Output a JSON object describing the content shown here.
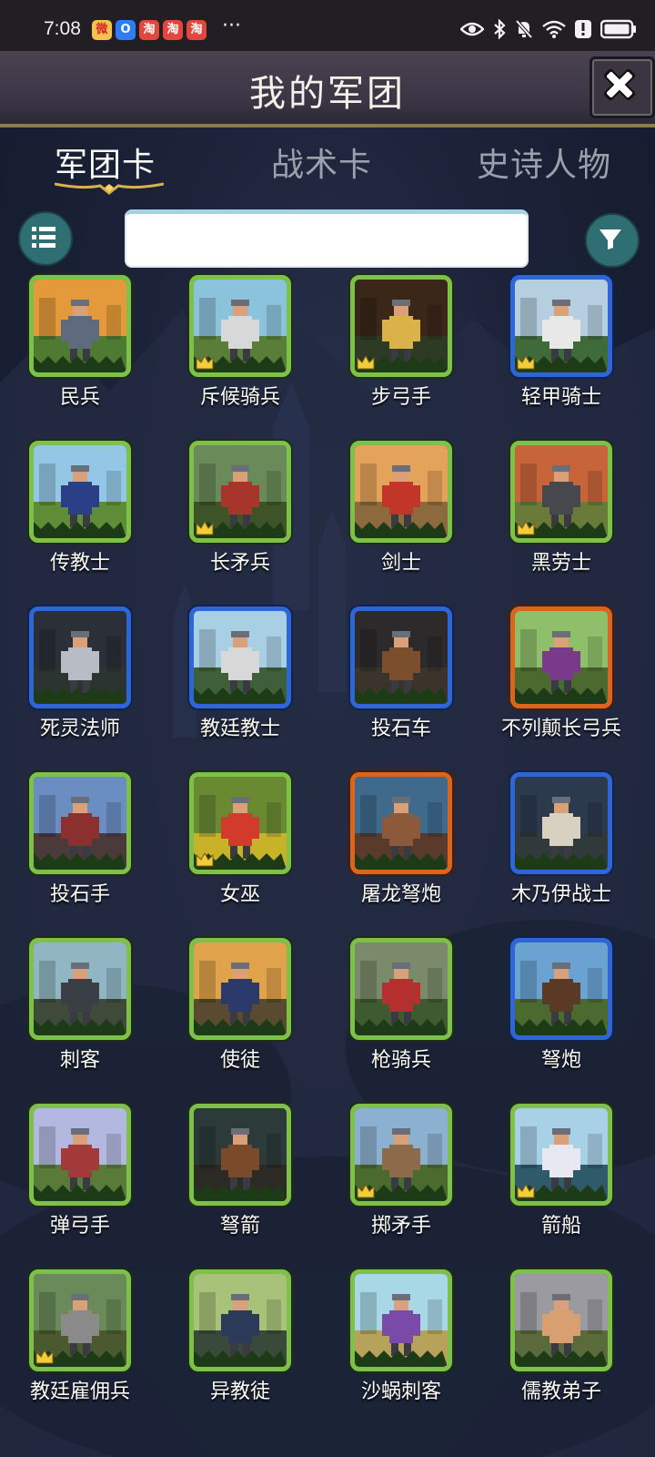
{
  "status_bar": {
    "time": "7:08",
    "more": "···",
    "apps": [
      {
        "name": "weibo-icon",
        "glyph": "微",
        "bg": "#f7c34a",
        "fg": "#d7262c"
      },
      {
        "name": "o-app-icon",
        "glyph": "O",
        "bg": "#2f7df2",
        "fg": "#ffffff"
      },
      {
        "name": "taobao-icon",
        "glyph": "淘",
        "bg": "#e1473c",
        "fg": "#ffffff"
      },
      {
        "name": "taobao-icon",
        "glyph": "淘",
        "bg": "#e1473c",
        "fg": "#ffffff"
      },
      {
        "name": "taobao-icon",
        "glyph": "淘",
        "bg": "#e1473c",
        "fg": "#ffffff"
      }
    ],
    "indicators": [
      "eye-icon",
      "bluetooth-icon",
      "mute-icon",
      "wifi-icon",
      "alert-icon",
      "battery-icon"
    ]
  },
  "header": {
    "title": "我的军团",
    "close_icon": "close-icon"
  },
  "tabs": [
    {
      "label": "军团卡",
      "active": true
    },
    {
      "label": "战术卡",
      "active": false
    },
    {
      "label": "史诗人物",
      "active": false
    }
  ],
  "toolbar": {
    "list_icon": "list-icon",
    "filter_icon": "filter-icon",
    "search_value": "",
    "search_placeholder": ""
  },
  "colors": {
    "green_frame": "#7ec14a",
    "blue_frame": "#2e66d6",
    "orange_frame": "#d9651f",
    "teal_button": "#2f6e72",
    "gold_crown": "#f3cc3a"
  },
  "cards": [
    {
      "name": "民兵",
      "frame": "green",
      "crown": false,
      "sky": "#e49a3a",
      "ground": "#4e7a32",
      "figure": "#5d6b7d"
    },
    {
      "name": "斥候骑兵",
      "frame": "green",
      "crown": true,
      "sky": "#8cc3dc",
      "ground": "#5b7d3a",
      "figure": "#d8d8d8"
    },
    {
      "name": "步弓手",
      "frame": "green",
      "crown": true,
      "sky": "#3a2718",
      "ground": "#2e3a24",
      "figure": "#d9b24a"
    },
    {
      "name": "轻甲骑士",
      "frame": "blue",
      "crown": true,
      "sky": "#b5cfe0",
      "ground": "#3f6b3a",
      "figure": "#e8e8e8"
    },
    {
      "name": "传教士",
      "frame": "green",
      "crown": false,
      "sky": "#93c7e5",
      "ground": "#5f8c36",
      "figure": "#2b3f87"
    },
    {
      "name": "长矛兵",
      "frame": "green",
      "crown": true,
      "sky": "#6a8a5a",
      "ground": "#3d5428",
      "figure": "#a8352c"
    },
    {
      "name": "剑士",
      "frame": "green",
      "crown": false,
      "sky": "#e3a35a",
      "ground": "#8c6a3e",
      "figure": "#c2362a"
    },
    {
      "name": "黑劳士",
      "frame": "green",
      "crown": true,
      "sky": "#c8643a",
      "ground": "#6a7a38",
      "figure": "#47484e"
    },
    {
      "name": "死灵法师",
      "frame": "blue",
      "crown": false,
      "sky": "#2b2f37",
      "ground": "#2c3431",
      "figure": "#b8bcc4"
    },
    {
      "name": "教廷教士",
      "frame": "blue",
      "crown": false,
      "sky": "#a9cfe5",
      "ground": "#3f5f3a",
      "figure": "#d8d8d8"
    },
    {
      "name": "投石车",
      "frame": "blue",
      "crown": false,
      "sky": "#2c2a2a",
      "ground": "#3a342c",
      "figure": "#7b4f2e"
    },
    {
      "name": "不列颠长弓兵",
      "frame": "orange",
      "crown": false,
      "sky": "#8fbf6a",
      "ground": "#4c6a30",
      "figure": "#7a3a8c"
    },
    {
      "name": "投石手",
      "frame": "green",
      "crown": false,
      "sky": "#6a8ec2",
      "ground": "#4b3a3a",
      "figure": "#8c2f2f"
    },
    {
      "name": "女巫",
      "frame": "green",
      "crown": true,
      "sky": "#6a8a32",
      "ground": "#c7b228",
      "figure": "#d23a2c"
    },
    {
      "name": "屠龙弩炮",
      "frame": "orange",
      "crown": false,
      "sky": "#3f6a8c",
      "ground": "#5a3a2a",
      "figure": "#8c5a3a"
    },
    {
      "name": "木乃伊战士",
      "frame": "blue",
      "crown": false,
      "sky": "#2c3a4e",
      "ground": "#303a3a",
      "figure": "#d8d0c0"
    },
    {
      "name": "刺客",
      "frame": "green",
      "crown": false,
      "sky": "#8fb6c2",
      "ground": "#3f4a3a",
      "figure": "#3a3f45"
    },
    {
      "name": "使徒",
      "frame": "green",
      "crown": false,
      "sky": "#e0a24a",
      "ground": "#5a4a30",
      "figure": "#2b3a6a"
    },
    {
      "name": "枪骑兵",
      "frame": "green",
      "crown": false,
      "sky": "#7a8a6a",
      "ground": "#3f5a2e",
      "figure": "#b52f2f"
    },
    {
      "name": "弩炮",
      "frame": "blue",
      "crown": false,
      "sky": "#6aa3d2",
      "ground": "#4a6a30",
      "figure": "#5a3a24"
    },
    {
      "name": "弹弓手",
      "frame": "green",
      "crown": false,
      "sky": "#b2b8e0",
      "ground": "#5a7a3a",
      "figure": "#a33a3a"
    },
    {
      "name": "弩箭",
      "frame": "green",
      "crown": false,
      "sky": "#2c3a3a",
      "ground": "#2c2a24",
      "figure": "#7a4a2a"
    },
    {
      "name": "掷矛手",
      "frame": "green",
      "crown": true,
      "sky": "#8cb0d0",
      "ground": "#4a6a2e",
      "figure": "#8c6a4a"
    },
    {
      "name": "箭船",
      "frame": "green",
      "crown": true,
      "sky": "#a8d0e6",
      "ground": "#2e5a6a",
      "figure": "#e8e8f0"
    },
    {
      "name": "教廷雇佣兵",
      "frame": "green",
      "crown": true,
      "sky": "#6a8a5a",
      "ground": "#4a5a2e",
      "figure": "#8a8a8a"
    },
    {
      "name": "异教徒",
      "frame": "green",
      "crown": false,
      "sky": "#a8c27a",
      "ground": "#3a4a3a",
      "figure": "#2c3a5a"
    },
    {
      "name": "沙蜗刺客",
      "frame": "green",
      "crown": false,
      "sky": "#a8d8e6",
      "ground": "#b6a25a",
      "figure": "#7a4aa8"
    },
    {
      "name": "儒教弟子",
      "frame": "green",
      "crown": false,
      "sky": "#9a9aa0",
      "ground": "#5a6a3a",
      "figure": "#d8a070"
    }
  ]
}
